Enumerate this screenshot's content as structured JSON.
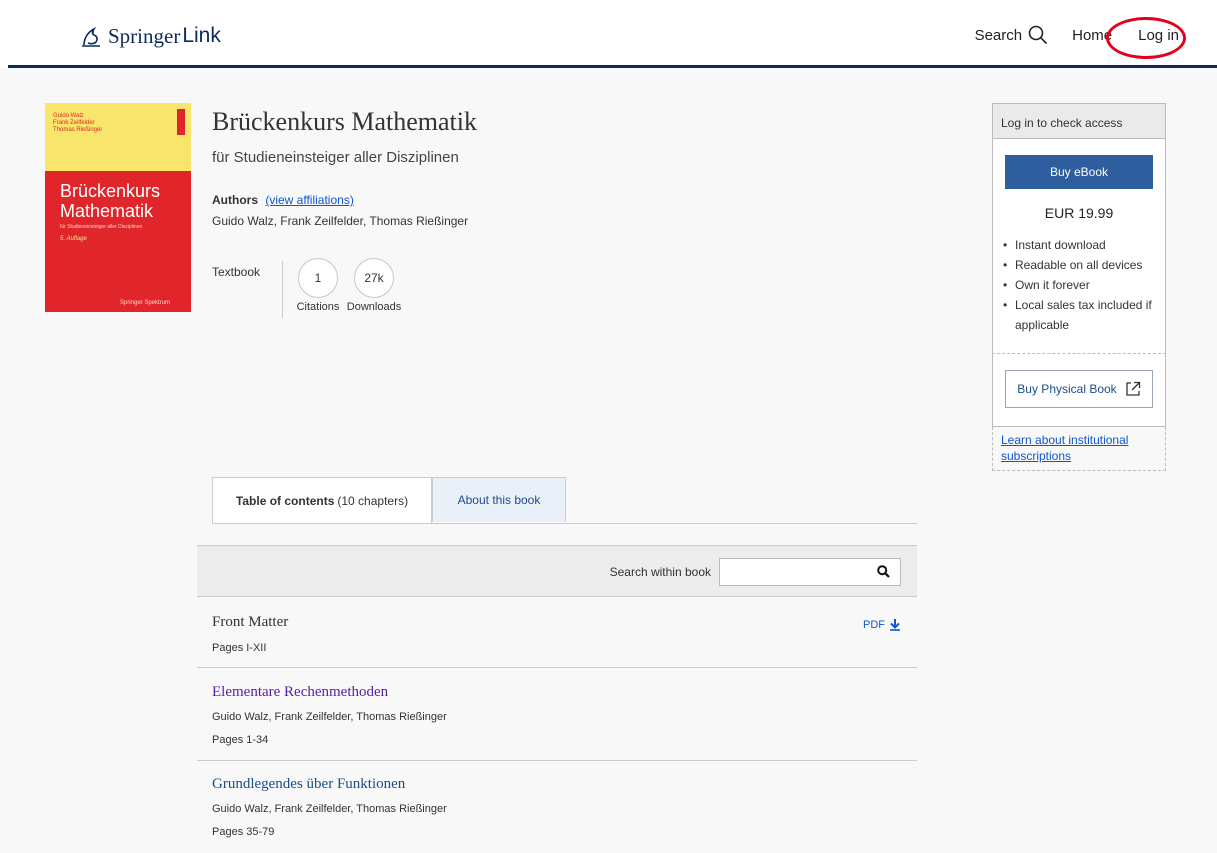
{
  "header": {
    "brand_main": "Springer",
    "brand_sub": "Link",
    "nav_search": "Search",
    "nav_home": "Home",
    "nav_login": "Log in"
  },
  "cover": {
    "authors": [
      "Guido Walz",
      "Frank Zeilfelder",
      "Thomas Rießinger"
    ],
    "title_line1": "Brückenkurs",
    "title_line2": "Mathematik",
    "subtitle": "für Studieneinsteiger aller Disziplinen",
    "edition": "5. Auflage",
    "publisher": "Springer Spektrum"
  },
  "book": {
    "title": "Brückenkurs Mathematik",
    "subtitle": "für Studieneinsteiger aller Disziplinen",
    "authors_label": "Authors",
    "affiliations_link": "(view affiliations)",
    "authors": "Guido Walz, Frank Zeilfelder, Thomas Rießinger",
    "type": "Textbook",
    "citations_value": "1",
    "citations_label": "Citations",
    "downloads_value": "27k",
    "downloads_label": "Downloads"
  },
  "tabs": {
    "toc_label": "Table of contents",
    "toc_count": "(10 chapters)",
    "about_label": "About this book"
  },
  "search": {
    "label": "Search within book",
    "value": ""
  },
  "chapters": [
    {
      "title": "Front Matter",
      "authors": "",
      "pages": "Pages I-XII",
      "pdf": "PDF"
    },
    {
      "title": "Elementare Rechenmethoden",
      "authors": "Guido Walz, Frank Zeilfelder, Thomas Rießinger",
      "pages": "Pages 1-34"
    },
    {
      "title": "Grundlegendes über Funktionen",
      "authors": "Guido Walz, Frank Zeilfelder, Thomas Rießinger",
      "pages": "Pages 35-79"
    }
  ],
  "sidebar": {
    "header": "Log in to check access",
    "buy_button": "Buy eBook",
    "price": "EUR 19.99",
    "benefits": [
      "Instant download",
      "Readable on all devices",
      "Own it forever",
      "Local sales tax included if applicable"
    ],
    "physical_button": "Buy Physical Book",
    "institutional_link": "Learn about institutional subscriptions"
  },
  "colors": {
    "brand_navy": "#0c2a5a",
    "link_blue": "#0b57d0",
    "visited_purple": "#5a1aa8",
    "buy_blue": "#2f5e9e",
    "annotation_red": "#e2001a"
  }
}
